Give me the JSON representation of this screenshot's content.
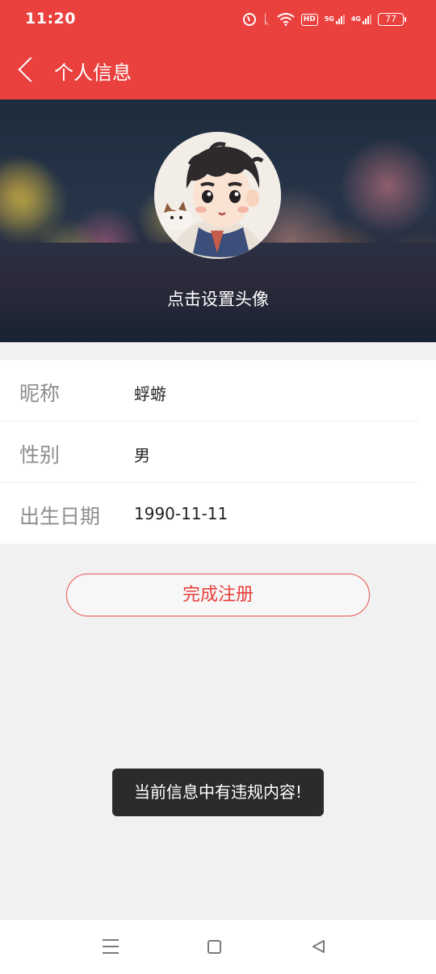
{
  "status_bar": {
    "time": "11:20",
    "hd_label": "HD",
    "net_5g": "5G",
    "net_4g": "4G",
    "battery": "77"
  },
  "header": {
    "title": "个人信息",
    "background_color": "#ea403e"
  },
  "profile": {
    "avatar_caption": "点击设置头像"
  },
  "form": {
    "rows": [
      {
        "label": "昵称",
        "value": "蜉蝣"
      },
      {
        "label": "性别",
        "value": "男"
      },
      {
        "label": "出生日期",
        "value": "1990-11-11"
      }
    ]
  },
  "actions": {
    "register_label": "完成注册",
    "accent_color": "#e8403c"
  },
  "toast": {
    "message": "当前信息中有违规内容!"
  },
  "icons": {
    "back": "chevron-left-icon",
    "alarm": "alarm-icon",
    "bluetooth": "bluetooth-icon",
    "wifi": "wifi-icon",
    "nav_menu": "menu-icon",
    "nav_home": "home-square-icon",
    "nav_back": "back-triangle-icon"
  }
}
